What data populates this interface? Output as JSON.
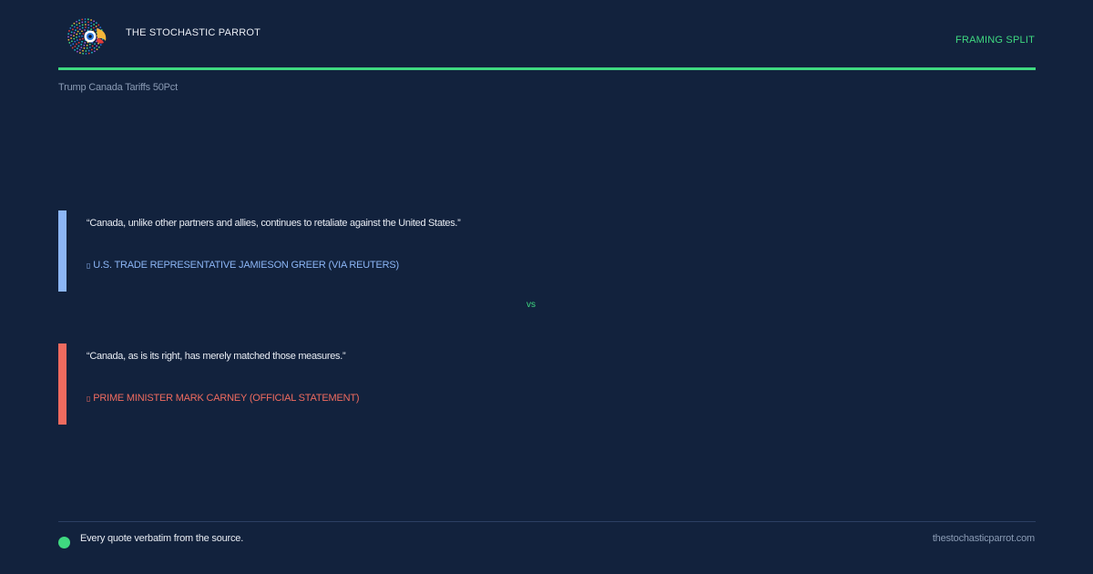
{
  "header": {
    "brand": "THE STOCHASTIC PARROT",
    "logo_icon": "parrot-logo-icon",
    "tag": "FRAMING SPLIT"
  },
  "subject": "Trump Canada Tariffs 50Pct",
  "quotes": [
    {
      "text": "“Canada, unlike other partners and allies, continues to retaliate against the United States.”",
      "attribution": "U.S. TRADE REPRESENTATIVE JAMIESON GREER (VIA REUTERS)",
      "color": "#8cb6f6"
    },
    {
      "text": "“Canada, as is its right, has merely matched those measures.”",
      "attribution": "PRIME MINISTER MARK CARNEY (OFFICIAL STATEMENT)",
      "color": "#ef6b5f"
    }
  ],
  "divider": "vs",
  "footer": {
    "note": "Every quote verbatim from the source.",
    "url": "thestochasticparrot.com"
  },
  "colors": {
    "background": "#12223d",
    "accent": "#3fd980",
    "muted": "#8a9bb4"
  }
}
